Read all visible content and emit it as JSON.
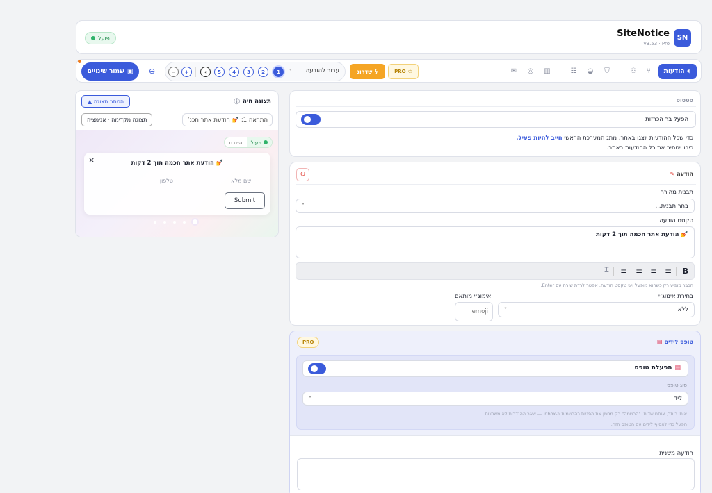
{
  "header": {
    "logo": "SN",
    "app_name": "SiteNotice",
    "version": "v3.53 · Pro",
    "status": "פועל"
  },
  "toolbar": {
    "notices_label": "הודעות",
    "pro_label": "PRO",
    "upgrade_label": "שדרוג",
    "goto_label": "עבור להודעה",
    "steps": [
      "1",
      "2",
      "3",
      "4",
      "5"
    ],
    "plus": "+",
    "minus": "−",
    "save_label": "שמור שינויים",
    "icons": [
      "speaker-icon",
      "branch-icon",
      "users-icon",
      "shield-icon",
      "palette-icon",
      "sliders-icon",
      "chart-icon",
      "ear-icon",
      "inbox-icon",
      "globe-icon",
      "save-icon"
    ]
  },
  "preview": {
    "title": "תצוגה חיה",
    "hide_button": "▲ הסתר תצוגה",
    "alert_select": "התראה 1: 💅 הודעת אתר חכמ...",
    "animation_button": "תצוגה מקדימה · אנימציה",
    "active_label": "פעיל",
    "disable_label": "השבת",
    "notice_text": "💅 הודעת אתר חכמה תוך 2 דקות",
    "field_name": "שם מלא",
    "field_phone": "טלפון",
    "submit": "Submit",
    "close": "×"
  },
  "status_section": {
    "title": "סטטוס",
    "toggle_label": "הפעל בר הכרזות",
    "desc_1_prefix": "כדי שכל ההודעות יוצגו באתר, מתג המערכת הראשי",
    "desc_1_bold": "חייב להיות פעיל.",
    "desc_2": "כיבוי יסתיר את כל ההודעות באתר."
  },
  "notice_section": {
    "title": "הודעה",
    "quick_template_label": "תבנית מהירה",
    "quick_template_value": "בחר תבנית...",
    "text_label": "טקסט הודעה",
    "text_value": "💅 הודעת אתר חכמה תוך 2 דקות",
    "editor_buttons": [
      "B",
      "≡",
      "≡",
      "≡",
      "≡",
      "Ꮖ"
    ],
    "hint": "הכבר מופיע רק כשהוא מופעל ויש טקסט הודעה. אפשר לרדת שורה עם Enter.",
    "emoji_label": "בחירת אימוג׳י",
    "emoji_value": "ללא",
    "custom_emoji_label": "אימוג׳י מותאם",
    "custom_emoji_placeholder": "emoji"
  },
  "lead_section": {
    "title": "טופס לידים",
    "pro": "PRO",
    "enable_label": "הפעלת טופס",
    "type_label": "סוג טופס",
    "type_value": "ליד",
    "note_1": "אותו כותר, אותם שדות. \"הרשמה\" רק מסמן את הפניות כהרשמות ב-Inbox — שאר ההגדרות לא משתנות.",
    "note_2": "הפעל כדי לאסוף לידים עם הטופס הזה."
  },
  "secondary": {
    "title": "הודעה משנית"
  },
  "colors": {
    "accent": "#3b5bdb",
    "upgrade": "#f5a524",
    "pro": "#b8860b",
    "active": "#2fb36a"
  }
}
